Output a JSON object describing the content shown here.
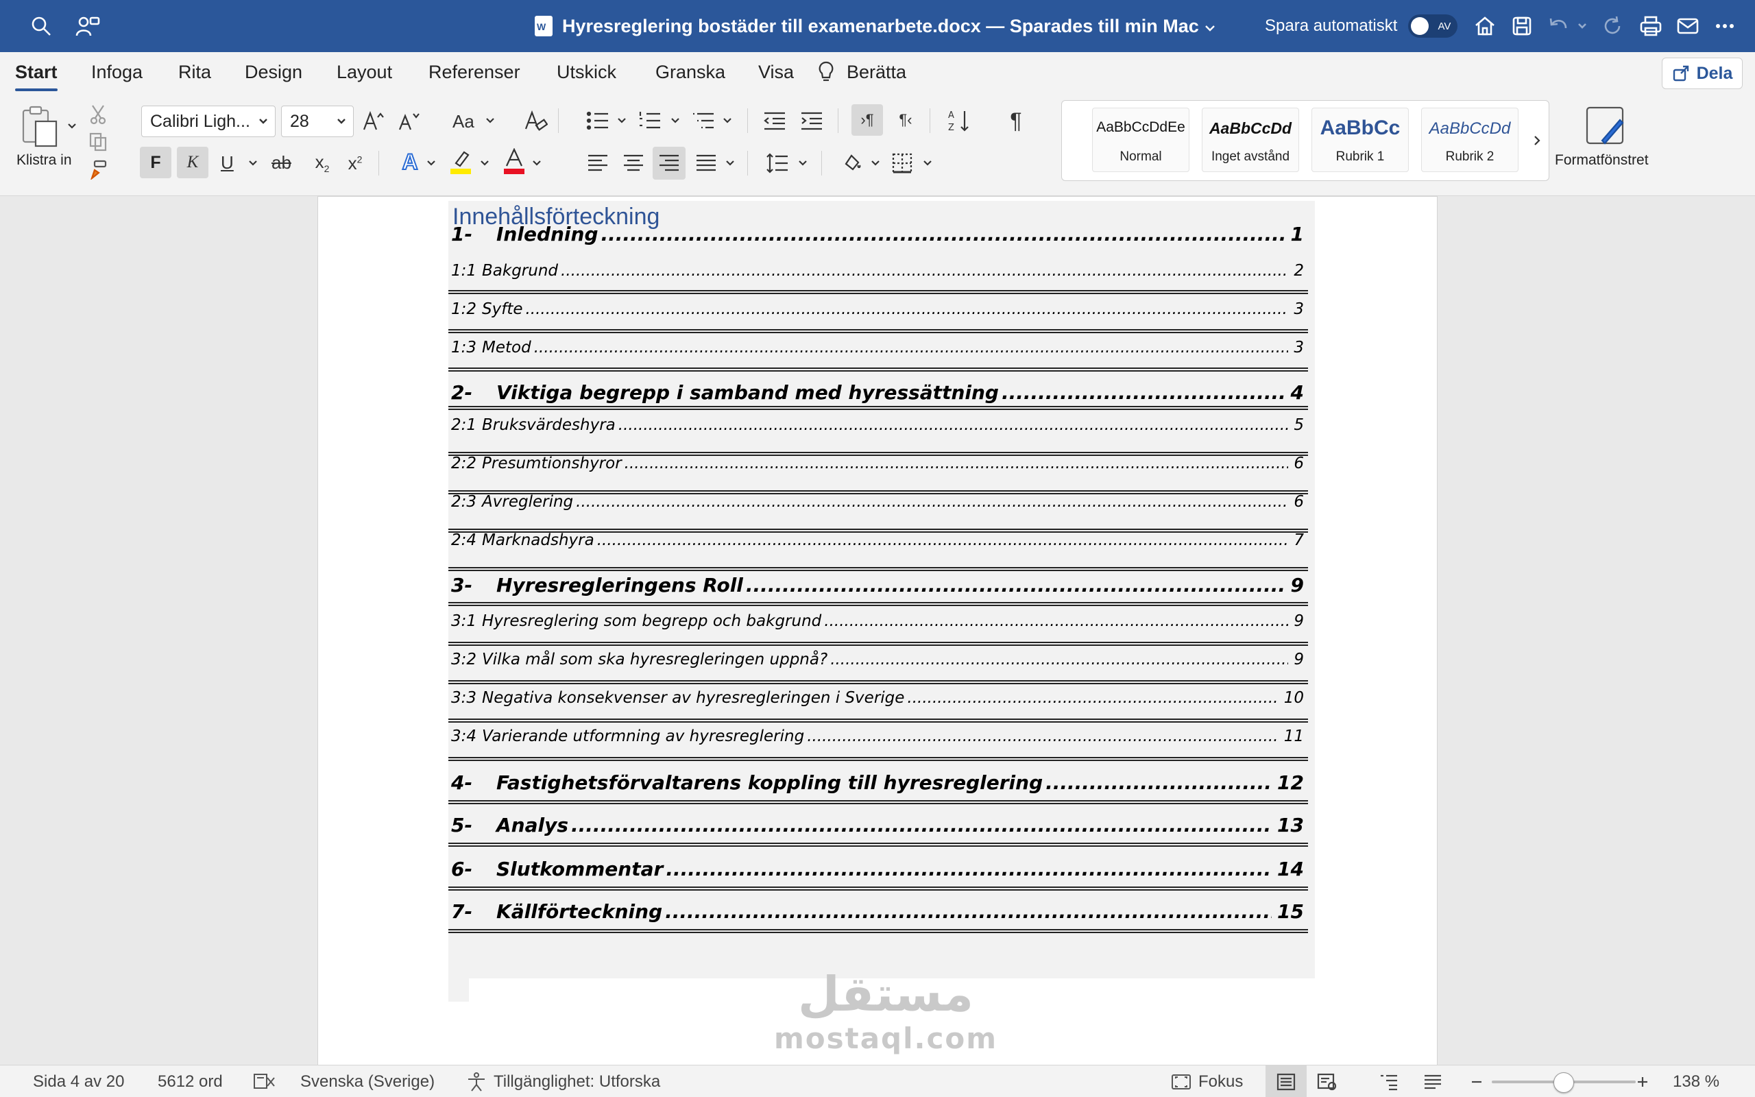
{
  "titlebar": {
    "doc_title": "Hyresreglering bostäder till examenarbete.docx — Sparades till min Mac",
    "autosave_label": "Spara automatiskt",
    "autosave_state": "AV"
  },
  "tabs": [
    "Start",
    "Infoga",
    "Rita",
    "Design",
    "Layout",
    "Referenser",
    "Utskick",
    "Granska",
    "Visa"
  ],
  "tell_me": "Berätta",
  "share_label": "Dela",
  "ribbon": {
    "paste_label": "Klistra in",
    "font_name": "Calibri Ligh...",
    "font_size": "28",
    "bold": "F",
    "italic": "K",
    "underline": "U",
    "strike": "ab",
    "change_case": "Aa",
    "styles": [
      {
        "sample": "AaBbCcDdEe",
        "name": "Normal"
      },
      {
        "sample": "AaBbCcDd",
        "name": "Inget avstånd"
      },
      {
        "sample": "AaBbCc",
        "name": "Rubrik 1"
      },
      {
        "sample": "AaBbCcDd",
        "name": "Rubrik 2"
      }
    ],
    "styles_pane": "Formatfönstret"
  },
  "document": {
    "toc_heading": "Innehållsförteckning",
    "toc": [
      {
        "level": 1,
        "num": "1-",
        "text": "Inledning",
        "page": "1"
      },
      {
        "level": 2,
        "num": "1:1",
        "text": "Bakgrund",
        "page": "2"
      },
      {
        "level": 2,
        "num": "1:2",
        "text": "Syfte",
        "page": "3"
      },
      {
        "level": 2,
        "num": "1:3",
        "text": "Metod",
        "page": "3"
      },
      {
        "level": 1,
        "num": "2-",
        "text": "Viktiga begrepp i samband med hyressättning",
        "page": "4"
      },
      {
        "level": 2,
        "num": "2:1",
        "text": "Bruksvärdeshyra",
        "page": "5"
      },
      {
        "level": 2,
        "num": "2:2",
        "text": "Presumtionshyror",
        "page": "6"
      },
      {
        "level": 2,
        "num": "2:3",
        "text": "Avreglering",
        "page": "6"
      },
      {
        "level": 2,
        "num": "2:4",
        "text": "Marknadshyra",
        "page": "7"
      },
      {
        "level": 1,
        "num": "3-",
        "text": "Hyresregleringens Roll",
        "page": "9"
      },
      {
        "level": 2,
        "num": "3:1",
        "text": "Hyresreglering som begrepp och bakgrund",
        "page": "9"
      },
      {
        "level": 2,
        "num": "3:2",
        "text": "Vilka mål som ska hyresregleringen uppnå?",
        "page": "9"
      },
      {
        "level": 2,
        "num": "3:3",
        "text": "Negativa konsekvenser av hyresregleringen i Sverige",
        "page": "10"
      },
      {
        "level": 2,
        "num": "3:4",
        "text": "Varierande utformning av hyresreglering",
        "page": "11"
      },
      {
        "level": 1,
        "num": "4-",
        "text": "Fastighetsförvaltarens koppling till hyresreglering",
        "page": "12"
      },
      {
        "level": 1,
        "num": "5-",
        "text": "Analys",
        "page": "13"
      },
      {
        "level": 1,
        "num": "6-",
        "text": "Slutkommentar",
        "page": "14"
      },
      {
        "level": 1,
        "num": "7-",
        "text": "Källförteckning",
        "page": "15"
      }
    ],
    "watermark_arabic": "مستقل",
    "watermark_latin": "mostaql.com"
  },
  "statusbar": {
    "page": "Sida 4 av 20",
    "words": "5612 ord",
    "language": "Svenska (Sverige)",
    "accessibility": "Tillgänglighet: Utforska",
    "focus": "Fokus",
    "zoom": "138 %"
  },
  "colors": {
    "titlebar": "#2b579a",
    "heading": "#2f5496"
  }
}
